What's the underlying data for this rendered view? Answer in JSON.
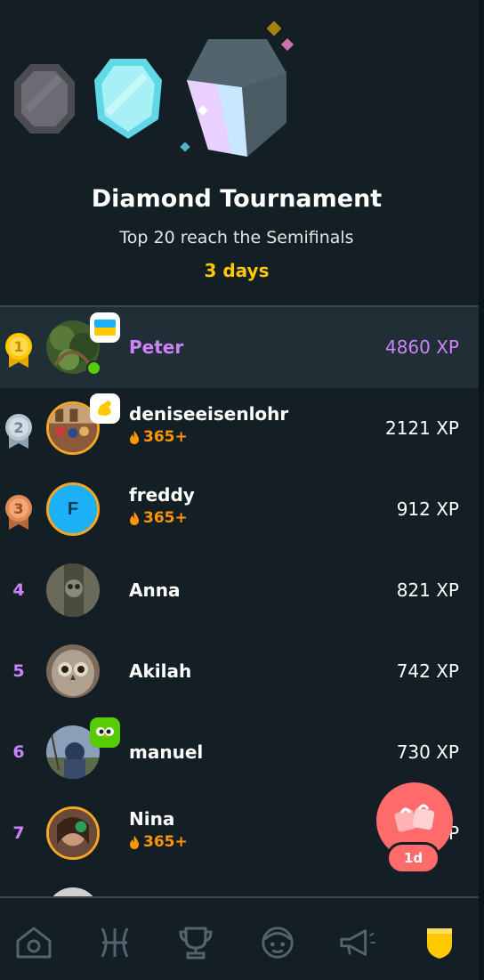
{
  "header": {
    "title": "Diamond Tournament",
    "subtitle": "Top 20 reach the Semifinals",
    "time_left": "3 days",
    "league_icons": [
      "obsidian-league-icon",
      "diamond-league-icon",
      "tournament-league-icon"
    ]
  },
  "leaderboard": [
    {
      "rank": "1",
      "medal": "gold",
      "name": "Peter",
      "xp": "4860 XP",
      "is_current_user": true,
      "badge": "ukraine-flag-icon",
      "online": true
    },
    {
      "rank": "2",
      "medal": "silver",
      "name": "deniseeisenlohr",
      "streak": "365+",
      "xp": "2121 XP",
      "badge": "flexed-arm-icon"
    },
    {
      "rank": "3",
      "medal": "bronze",
      "name": "freddy",
      "avatar_letter": "F",
      "streak": "365+",
      "xp": "912 XP"
    },
    {
      "rank": "4",
      "name": "Anna",
      "xp": "821 XP"
    },
    {
      "rank": "5",
      "name": "Akilah",
      "xp": "742 XP"
    },
    {
      "rank": "6",
      "name": "manuel",
      "xp": "730 XP",
      "badge": "duo-owl-icon"
    },
    {
      "rank": "7",
      "name": "Nina",
      "streak": "365+",
      "xp": "??? XP"
    }
  ],
  "floating_button": {
    "icon": "gift-box-icon",
    "badge": "1d"
  },
  "nav": {
    "items": [
      "home-icon",
      "alphabet-icon",
      "trophy-icon",
      "characters-icon",
      "megaphone-icon",
      "league-shield-icon"
    ],
    "active": "league-shield-icon"
  },
  "colors": {
    "background": "#131f24",
    "highlight_row": "#202f36",
    "accent_purple": "#ce82ff",
    "accent_gold": "#ffc800",
    "streak_orange": "#ff9600"
  }
}
